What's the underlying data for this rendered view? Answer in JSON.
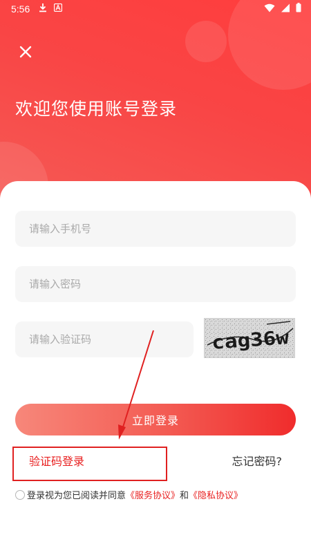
{
  "status_bar": {
    "time": "5:56"
  },
  "header": {
    "title": "欢迎您使用账号登录"
  },
  "form": {
    "phone_placeholder": "请输入手机号",
    "password_placeholder": "请输入密码",
    "captcha_placeholder": "请输入验证码",
    "captcha_text": "cag36w",
    "login_button": "立即登录"
  },
  "links": {
    "sms_login": "验证码登录",
    "forgot_password": "忘记密码?"
  },
  "agreement": {
    "prefix": "登录视为您已阅读并同意",
    "service": "《服务协议》",
    "and": "和",
    "privacy": "《隐私协议》"
  },
  "colors": {
    "brand_red": "#f94545",
    "link_red": "#e81f1f",
    "annotation_red": "#e02020"
  },
  "icons": {
    "download": "download-icon",
    "notification_a": "a-notification-icon",
    "wifi": "wifi-icon",
    "signal": "signal-icon",
    "battery": "battery-icon",
    "close": "close-icon"
  }
}
